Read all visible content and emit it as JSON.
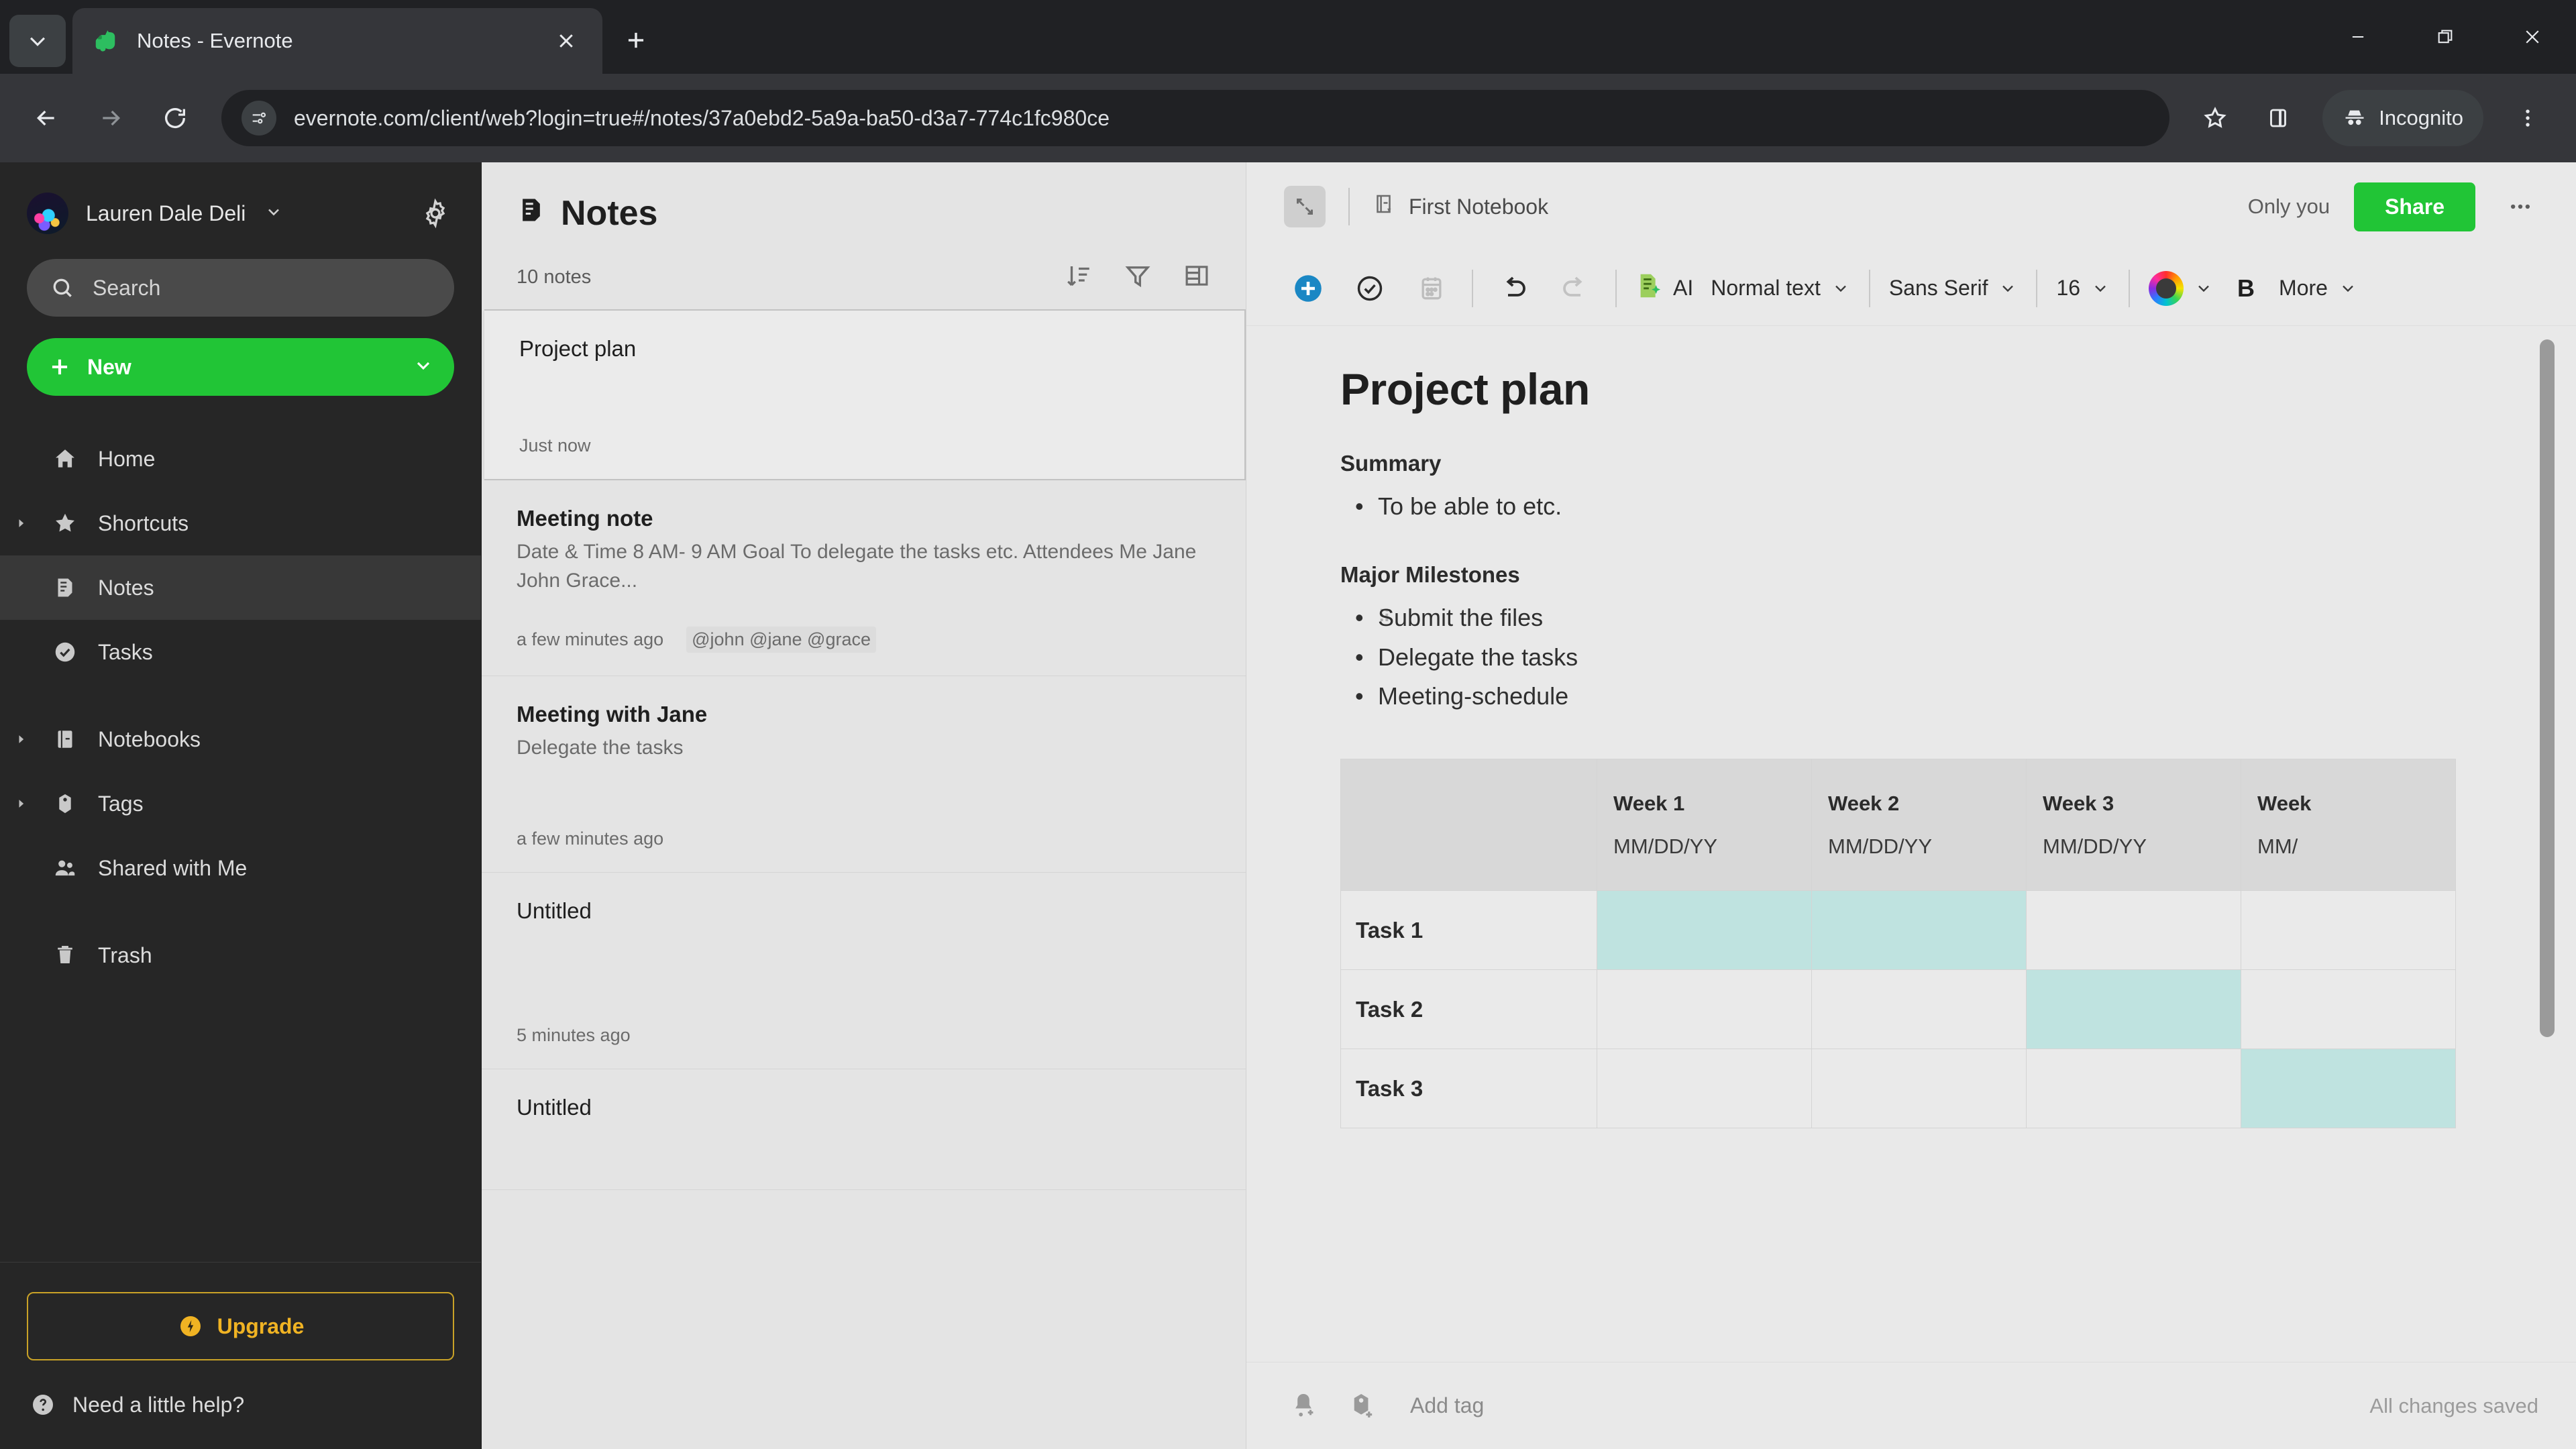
{
  "browser": {
    "tab": {
      "title": "Notes - Evernote",
      "favicon": "evernote-elephant-icon"
    },
    "tab_search_icon": "chevron-down-icon",
    "new_tab_icon": "plus-icon",
    "window_controls": {
      "minimize": "minimize-icon",
      "maximize": "maximize-icon",
      "close": "close-icon"
    },
    "nav": {
      "back": "back-arrow-icon",
      "forward": "forward-arrow-icon",
      "reload": "reload-icon"
    },
    "omnibox": {
      "site_info_icon": "site-settings-icon",
      "url": "evernote.com/client/web?login=true#/notes/37a0ebd2-5a9a-ba50-d3a7-774c1fc980ce"
    },
    "toolbar": {
      "bookmark_icon": "star-icon",
      "sidepanel_icon": "side-panel-icon",
      "profile_label": "Incognito",
      "profile_icon": "incognito-icon",
      "menu_icon": "kebab-menu-icon"
    }
  },
  "sidebar": {
    "account": {
      "name": "Lauren Dale Deli",
      "caret_icon": "chevron-down-icon",
      "settings_icon": "gear-icon",
      "avatar": "user-avatar"
    },
    "search": {
      "placeholder": "Search",
      "icon": "search-icon"
    },
    "new_button": {
      "label": "New",
      "plus_icon": "plus-icon",
      "caret_icon": "chevron-down-icon"
    },
    "items": [
      {
        "label": "Home",
        "icon": "home-icon",
        "twisty": false,
        "active": false
      },
      {
        "label": "Shortcuts",
        "icon": "star-icon",
        "twisty": true,
        "active": false
      },
      {
        "label": "Notes",
        "icon": "note-icon",
        "twisty": false,
        "active": true
      },
      {
        "label": "Tasks",
        "icon": "check-circle-icon",
        "twisty": false,
        "active": false
      },
      {
        "label": "Notebooks",
        "icon": "notebook-icon",
        "twisty": true,
        "active": false
      },
      {
        "label": "Tags",
        "icon": "tag-icon",
        "twisty": true,
        "active": false
      },
      {
        "label": "Shared with Me",
        "icon": "people-icon",
        "twisty": false,
        "active": false
      },
      {
        "label": "Trash",
        "icon": "trash-icon",
        "twisty": false,
        "active": false
      }
    ],
    "upgrade": {
      "label": "Upgrade",
      "icon": "bolt-badge-icon"
    },
    "help": {
      "label": "Need a little help?",
      "icon": "question-circle-icon"
    }
  },
  "notelist": {
    "title": "Notes",
    "title_icon": "note-icon",
    "count": "10 notes",
    "actions": [
      {
        "name": "sort",
        "icon": "sort-descending-icon"
      },
      {
        "name": "filter",
        "icon": "filter-icon"
      },
      {
        "name": "view",
        "icon": "list-view-icon"
      }
    ],
    "notes": [
      {
        "title": "Project plan",
        "snippet": "",
        "time": "Just now",
        "tags": "",
        "selected": true
      },
      {
        "title": "Meeting note",
        "snippet": "Date & Time 8 AM- 9 AM Goal To delegate the tasks etc. Attendees Me Jane John Grace...",
        "time": "a few minutes ago",
        "tags": "@john @jane @grace",
        "selected": false
      },
      {
        "title": "Meeting with Jane",
        "snippet": "Delegate the tasks",
        "time": "a few minutes ago",
        "tags": "",
        "selected": false
      },
      {
        "title": "Untitled",
        "snippet": "",
        "time": "5 minutes ago",
        "tags": "",
        "selected": false
      },
      {
        "title": "Untitled",
        "snippet": "",
        "time": "",
        "tags": "",
        "selected": false
      }
    ]
  },
  "editor": {
    "header": {
      "expand_icon": "expand-note-icon",
      "notebook": "First Notebook",
      "notebook_icon": "notebook-icon",
      "privacy": "Only you",
      "share_label": "Share",
      "more_icon": "ellipsis-icon"
    },
    "toolbar": {
      "insert_icon": "plus-circle-icon",
      "task_icon": "check-circle-icon",
      "calendar_icon": "calendar-icon",
      "undo_icon": "undo-icon",
      "redo_icon": "redo-icon",
      "ai_icon": "ai-sparkle-icon",
      "ai_label": "AI",
      "paragraph_style": "Normal text",
      "font_family": "Sans Serif",
      "font_size": "16",
      "color_icon": "color-wheel-icon",
      "bold_label": "B",
      "more_label": "More",
      "caret_icon": "chevron-down-icon"
    },
    "note": {
      "title": "Project plan",
      "sections": [
        {
          "heading": "Summary",
          "items": [
            "To be able to etc."
          ]
        },
        {
          "heading": "Major Milestones",
          "items": [
            "Submit the files",
            "Delegate the tasks",
            "Meeting-schedule"
          ]
        }
      ]
    },
    "table": {
      "corner": "",
      "columns": [
        {
          "week": "Week 1",
          "date": "MM/DD/YY"
        },
        {
          "week": "Week 2",
          "date": "MM/DD/YY"
        },
        {
          "week": "Week 3",
          "date": "MM/DD/YY"
        },
        {
          "week": "Week",
          "date": "MM/"
        }
      ],
      "rows": [
        {
          "label": "Task 1",
          "filled": [
            true,
            true,
            false,
            false
          ]
        },
        {
          "label": "Task 2",
          "filled": [
            false,
            false,
            true,
            false
          ]
        },
        {
          "label": "Task 3",
          "filled": [
            false,
            false,
            false,
            true
          ]
        }
      ],
      "fill_color": "#bfe3e0"
    },
    "footer": {
      "reminder_icon": "bell-plus-icon",
      "tag_icon": "tag-plus-icon",
      "add_tag": "Add tag",
      "status": "All changes saved"
    }
  },
  "colors": {
    "evernote_green": "#21c536",
    "upgrade_gold": "#f0b323",
    "chrome_dark": "#202124",
    "table_fill": "#bfe3e0"
  }
}
